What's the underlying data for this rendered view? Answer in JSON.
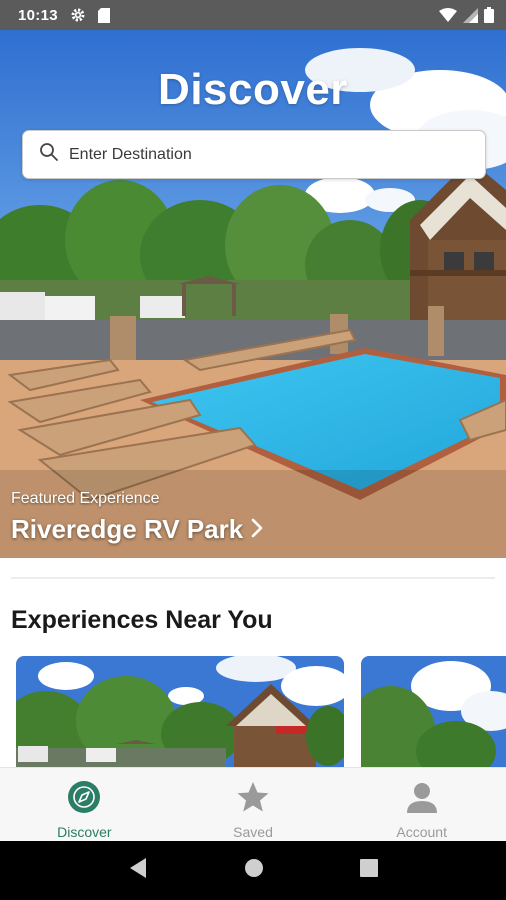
{
  "status_bar": {
    "time": "10:13",
    "icons": [
      "gear-icon",
      "sd-card-icon",
      "wifi-icon",
      "signal-icon",
      "battery-icon"
    ]
  },
  "hero": {
    "title": "Discover",
    "search_placeholder": "Enter Destination",
    "featured_caption": "Featured Experience",
    "featured_name": "Riveredge RV Park"
  },
  "section": {
    "title": "Experiences Near You"
  },
  "bottom_nav": {
    "items": [
      {
        "label": "Discover",
        "icon": "compass-icon",
        "active": true
      },
      {
        "label": "Saved",
        "icon": "star-icon",
        "active": false
      },
      {
        "label": "Account",
        "icon": "person-icon",
        "active": false
      }
    ]
  },
  "colors": {
    "accent": "#2b7d66",
    "inactive": "#9a9a9a",
    "status_bar": "#5b5b5b"
  }
}
